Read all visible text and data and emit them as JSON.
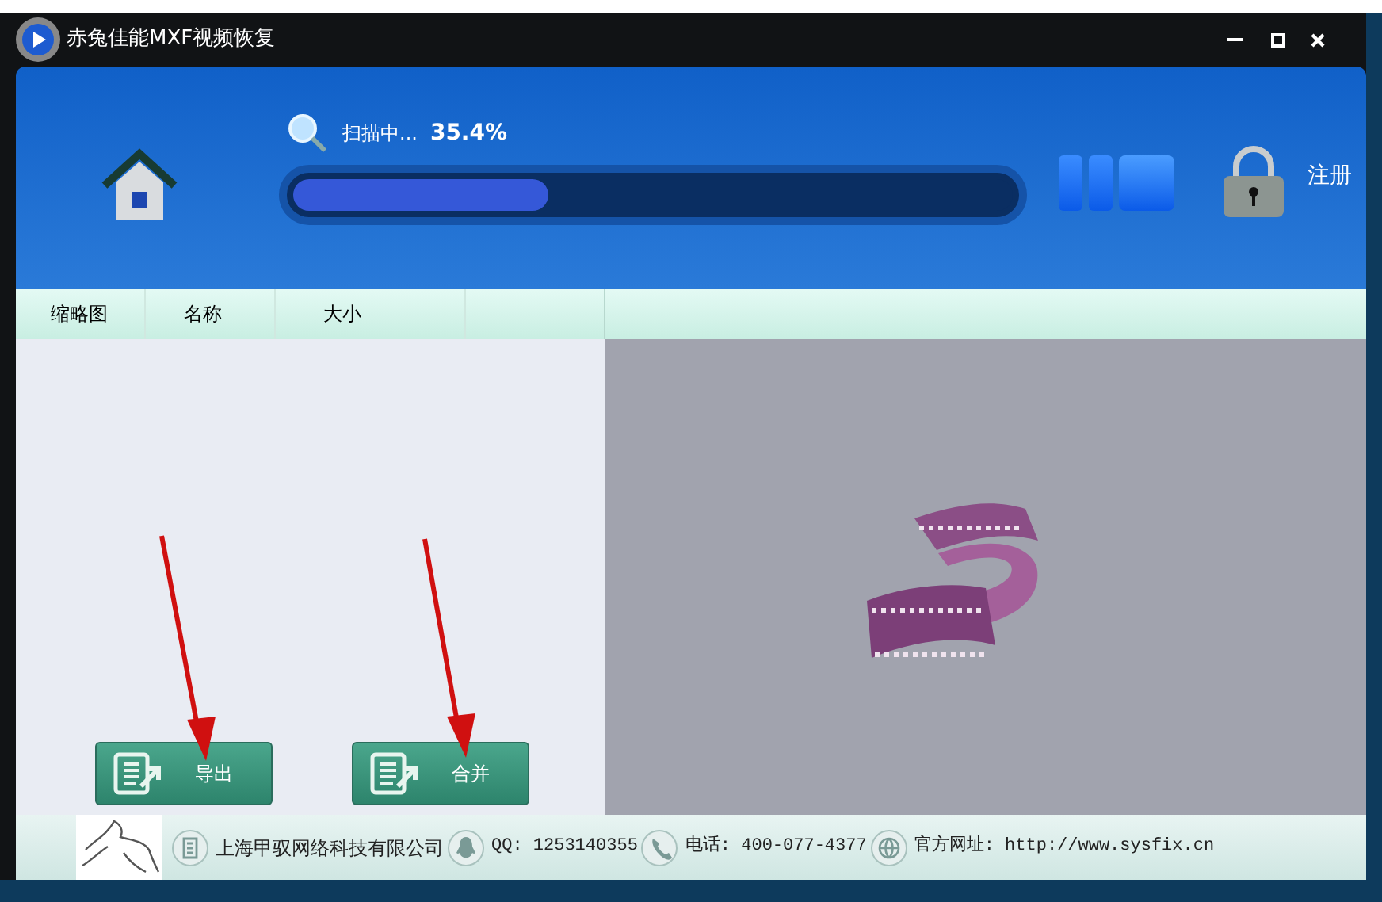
{
  "window": {
    "title": "赤兔佳能MXF视频恢复"
  },
  "scan": {
    "status": "扫描中...",
    "percent": "35.4%",
    "level": 0.354
  },
  "register": {
    "label": "注册"
  },
  "columns": [
    {
      "label": "缩略图"
    },
    {
      "label": "名称"
    },
    {
      "label": "大小"
    }
  ],
  "buttons": [
    {
      "label": "导出"
    },
    {
      "label": "合并"
    }
  ],
  "footer": [
    {
      "kind": "company",
      "text": "上海甲驭网络科技有限公司"
    },
    {
      "kind": "qq",
      "text": "QQ: 1253140355"
    },
    {
      "kind": "phone",
      "text": "电话: 400-077-4377"
    },
    {
      "kind": "web",
      "text": "官方网址: http://www.sysfix.cn"
    }
  ]
}
